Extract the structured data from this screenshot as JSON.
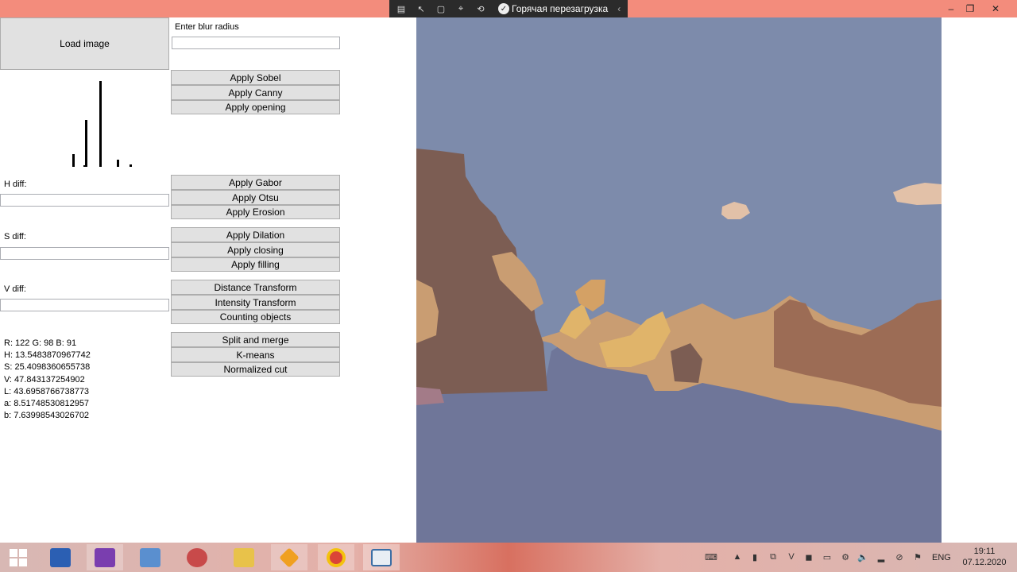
{
  "debug_toolbar": {
    "hot_reload_label": "Горячая перезагрузка"
  },
  "form": {
    "load_button": "Load image",
    "blur_label": "Enter blur radius",
    "blur_value": "",
    "h_diff_label": "H diff:",
    "s_diff_label": "S diff:",
    "v_diff_label": "V diff:",
    "buttons": [
      "Apply Sobel",
      "Apply Canny",
      "Apply opening",
      "Apply Gabor",
      "Apply Otsu",
      "Apply Erosion",
      "Apply Dilation",
      "Apply closing",
      "Apply filling",
      "Distance Transform",
      "Intensity Transform",
      "Counting objects",
      "Split and merge",
      "K-means",
      "Normalized cut"
    ]
  },
  "histogram": {
    "bars": [
      0.15,
      0.55,
      1.0,
      0.08,
      0.03,
      0.02
    ]
  },
  "pixel_info": {
    "rgb": "R: 122 G: 98 B: 91",
    "h": "H: 13.5483870967742",
    "s": "S: 25.4098360655738",
    "v": "V: 47.843137254902",
    "l": "L: 43.6958766738773",
    "a": "a: 8.51748530812957",
    "b": "b: 7.63998543026702"
  },
  "colors": {
    "titlebar": "#f38c7c",
    "sky": "#7d8bab",
    "ground": "#6f7699",
    "dark_brown": "#7c5d53",
    "tan": "#c99d72",
    "light_tan": "#d8b08a",
    "gold": "#e0b46a",
    "sand": "#d8c0a8"
  },
  "taskbar": {
    "lang": "ENG",
    "time": "19:11",
    "date": "07.12.2020"
  }
}
